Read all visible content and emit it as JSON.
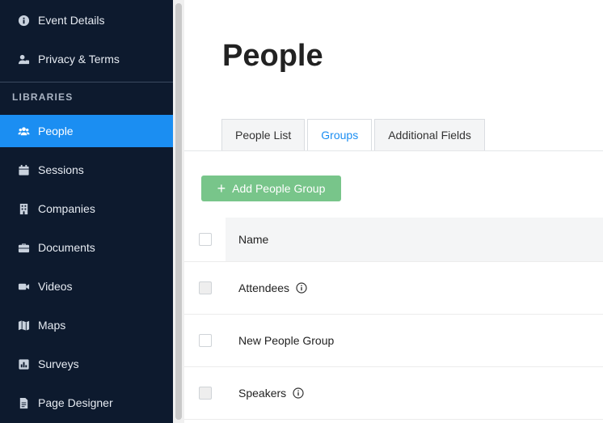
{
  "sidebar": {
    "top_items": [
      {
        "label": "Event Details",
        "icon": "info-circle-icon"
      },
      {
        "label": "Privacy & Terms",
        "icon": "user-lock-icon"
      }
    ],
    "section_header": "LIBRARIES",
    "items": [
      {
        "label": "People",
        "icon": "users-icon",
        "active": true
      },
      {
        "label": "Sessions",
        "icon": "calendar-icon"
      },
      {
        "label": "Companies",
        "icon": "building-icon"
      },
      {
        "label": "Documents",
        "icon": "briefcase-icon"
      },
      {
        "label": "Videos",
        "icon": "video-camera-icon"
      },
      {
        "label": "Maps",
        "icon": "map-icon"
      },
      {
        "label": "Surveys",
        "icon": "chart-icon"
      },
      {
        "label": "Page Designer",
        "icon": "file-icon"
      }
    ]
  },
  "main": {
    "title": "People",
    "tabs": [
      {
        "label": "People List",
        "active": false
      },
      {
        "label": "Groups",
        "active": true
      },
      {
        "label": "Additional Fields",
        "active": false
      }
    ],
    "add_button_label": "Add People Group",
    "table": {
      "header": "Name",
      "rows": [
        {
          "name": "Attendees",
          "info": true
        },
        {
          "name": "New People Group",
          "info": false
        },
        {
          "name": "Speakers",
          "info": true
        }
      ]
    }
  },
  "colors": {
    "sidebar_bg": "#0d1a2e",
    "accent": "#1b8ef2",
    "add_button": "#78c58a"
  }
}
